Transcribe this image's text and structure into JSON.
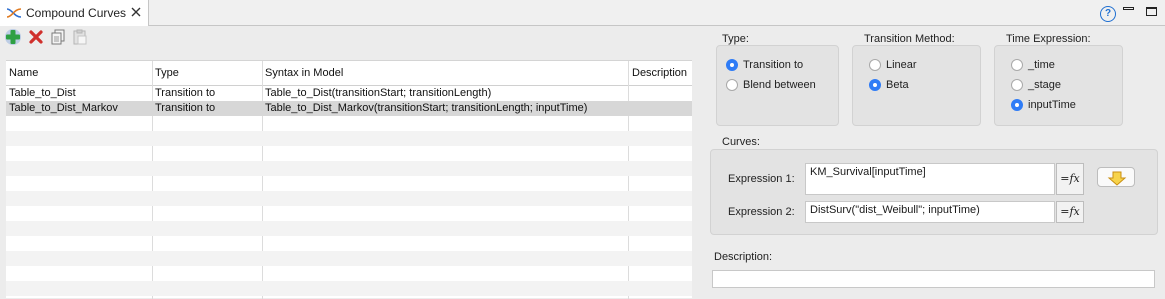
{
  "tab": {
    "title": "Compound Curves"
  },
  "table": {
    "columns": [
      "Name",
      "Type",
      "Syntax in Model",
      "Description"
    ],
    "rows": [
      {
        "name": "Table_to_Dist",
        "type": "Transition to",
        "syntax": "Table_to_Dist(transitionStart; transitionLength)",
        "description": ""
      },
      {
        "name": "Table_to_Dist_Markov",
        "type": "Transition to",
        "syntax": "Table_to_Dist_Markov(transitionStart; transitionLength; inputTime)",
        "description": ""
      }
    ],
    "selected_row": 1
  },
  "type_group": {
    "label": "Type:",
    "options": [
      "Transition to",
      "Blend between"
    ],
    "selected": "Transition to"
  },
  "method_group": {
    "label": "Transition Method:",
    "options": [
      "Linear",
      "Beta"
    ],
    "selected": "Beta"
  },
  "time_group": {
    "label": "Time Expression:",
    "options": [
      "_time",
      "_stage",
      "inputTime"
    ],
    "selected": "inputTime"
  },
  "curves": {
    "label": "Curves:",
    "expression1_label": "Expression 1:",
    "expression1_value": "KM_Survival[inputTime]",
    "expression2_label": "Expression 2:",
    "expression2_value": "DistSurv(\"dist_Weibull\"; inputTime)",
    "fx_label": "=fx"
  },
  "description": {
    "label": "Description:",
    "value": ""
  },
  "colors": {
    "accent": "#2f7cf6",
    "selected_row": "#d7d7d7",
    "add": "#2ea043",
    "delete": "#d0302c"
  }
}
